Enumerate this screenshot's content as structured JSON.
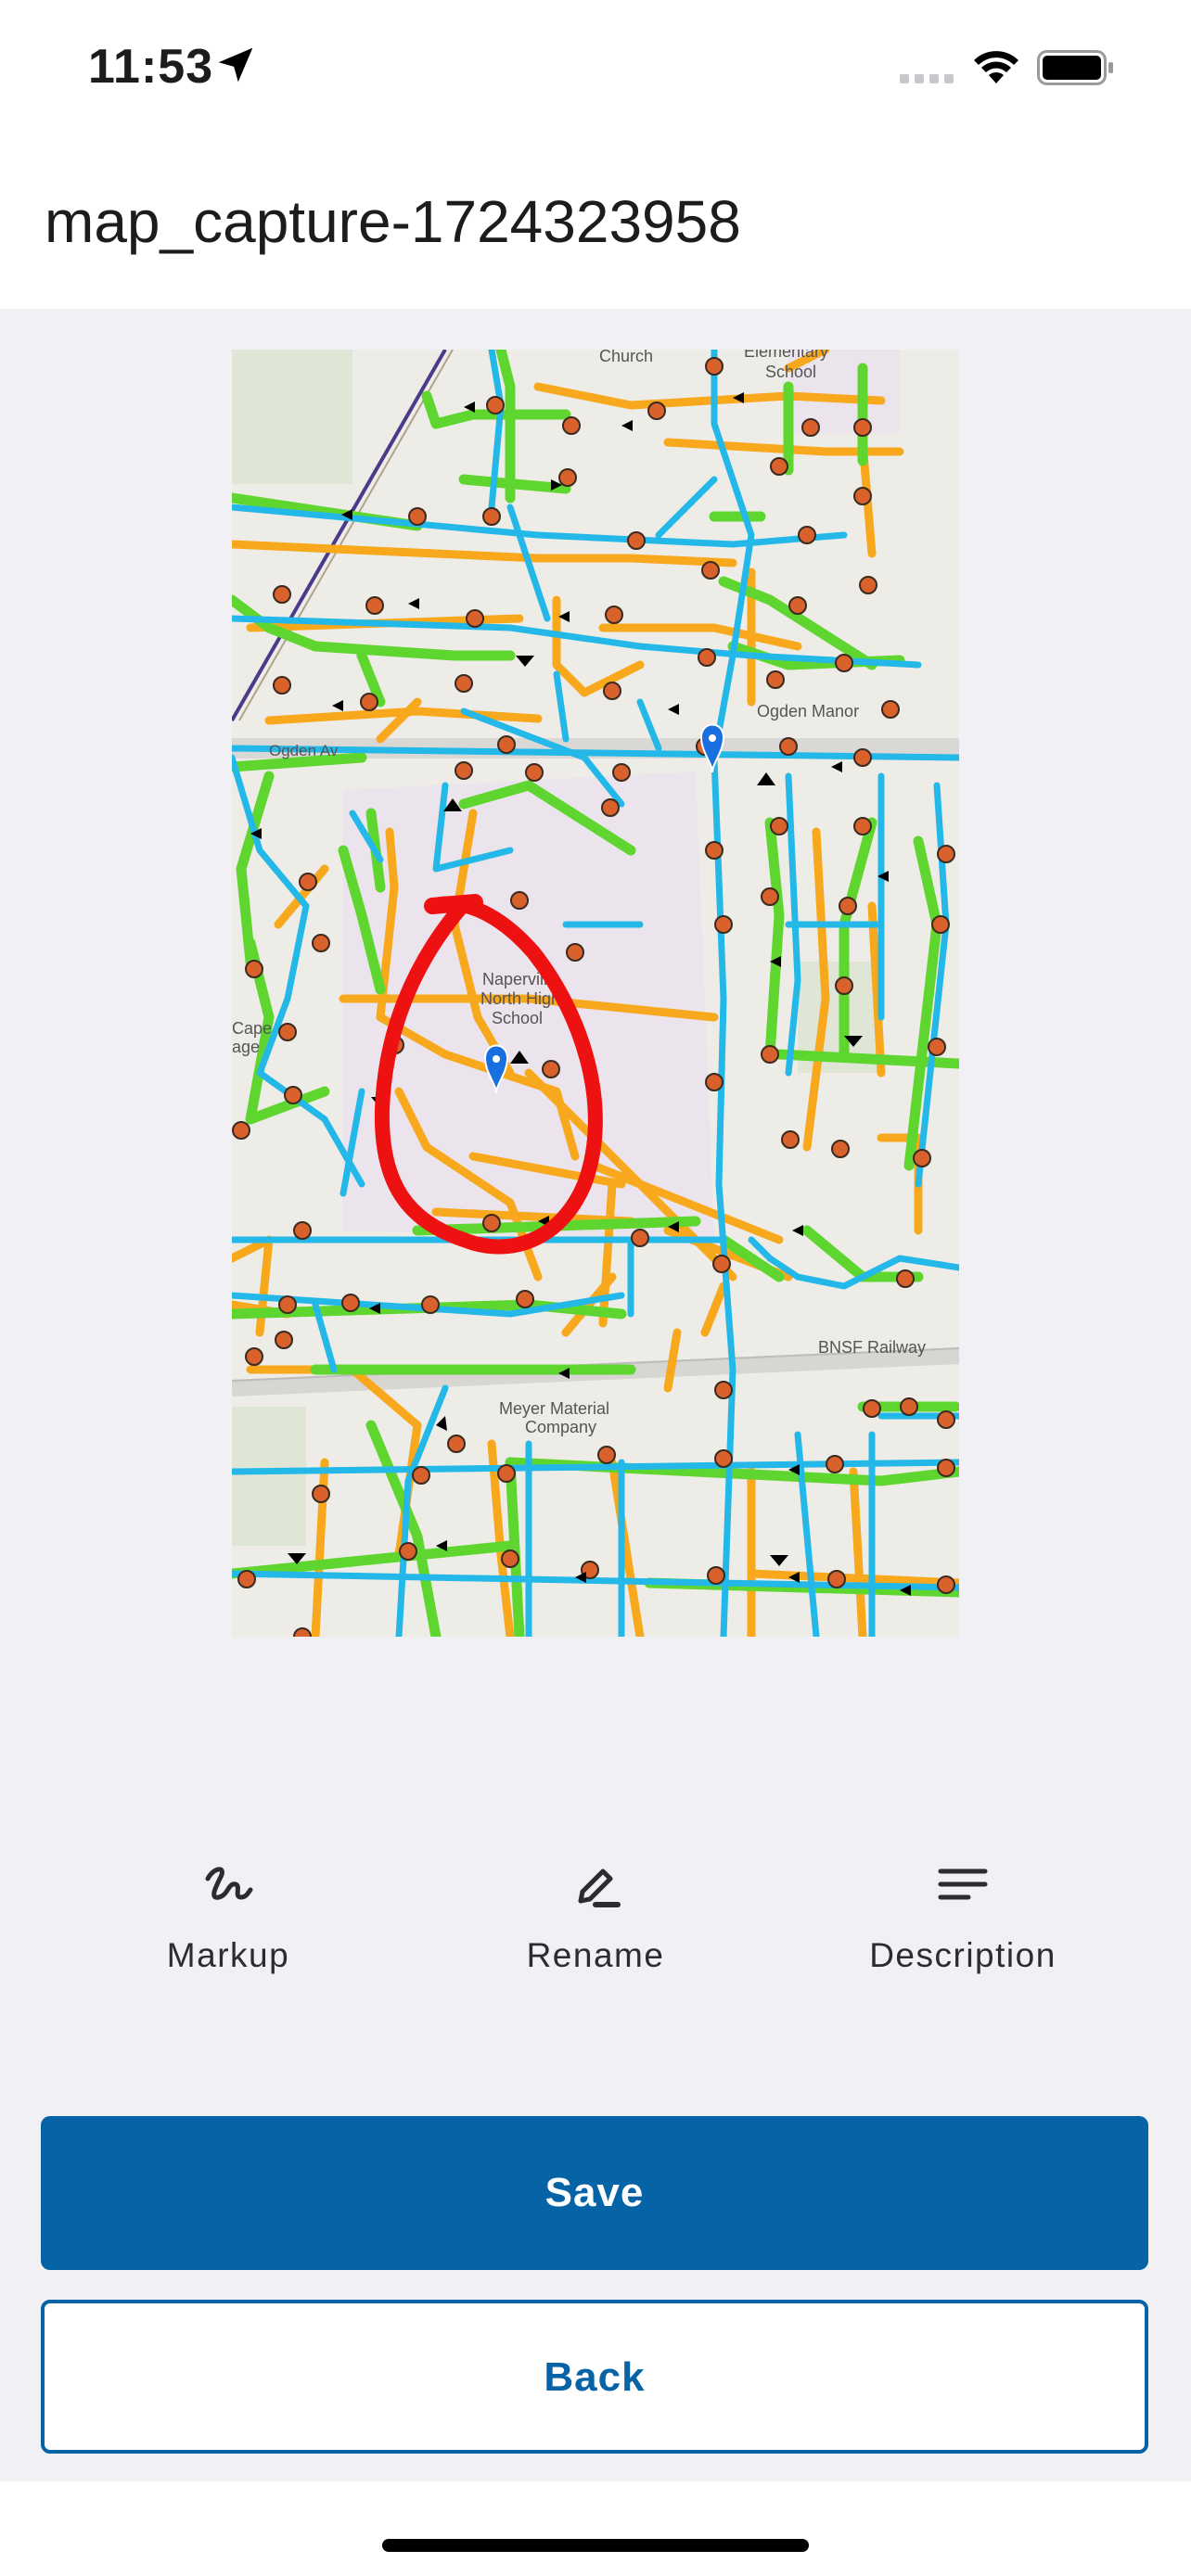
{
  "status_bar": {
    "time": "11:53",
    "icons": [
      "location-arrow-icon",
      "signal-icon",
      "wifi-icon",
      "battery-icon"
    ]
  },
  "header": {
    "title": "map_capture-1724323958"
  },
  "map": {
    "labels": {
      "church": "Church",
      "elementary": "Elementary",
      "school": "School",
      "ogden_manor": "Ogden Manor",
      "ogden_av": "Ogden Av",
      "naperville": "Naperville",
      "north_high": "North High",
      "school2": "School",
      "cape": "Cape",
      "age": "age",
      "bnsf": "BNSF Railway",
      "meyer": "Meyer Material",
      "company": "Company"
    },
    "colors": {
      "background": "#eeece6",
      "school_area": "#ece4ec",
      "water_line": "#23b8e8",
      "green_line": "#5fd630",
      "orange_line": "#f8a81c",
      "markup": "#ee1111",
      "pin": "#1a6fe0",
      "node": "#d9612c"
    }
  },
  "actions": [
    {
      "label": "Markup",
      "icon": "markup-squiggle-icon"
    },
    {
      "label": "Rename",
      "icon": "pencil-icon"
    },
    {
      "label": "Description",
      "icon": "text-lines-icon"
    }
  ],
  "buttons": {
    "save": "Save",
    "back": "Back"
  }
}
